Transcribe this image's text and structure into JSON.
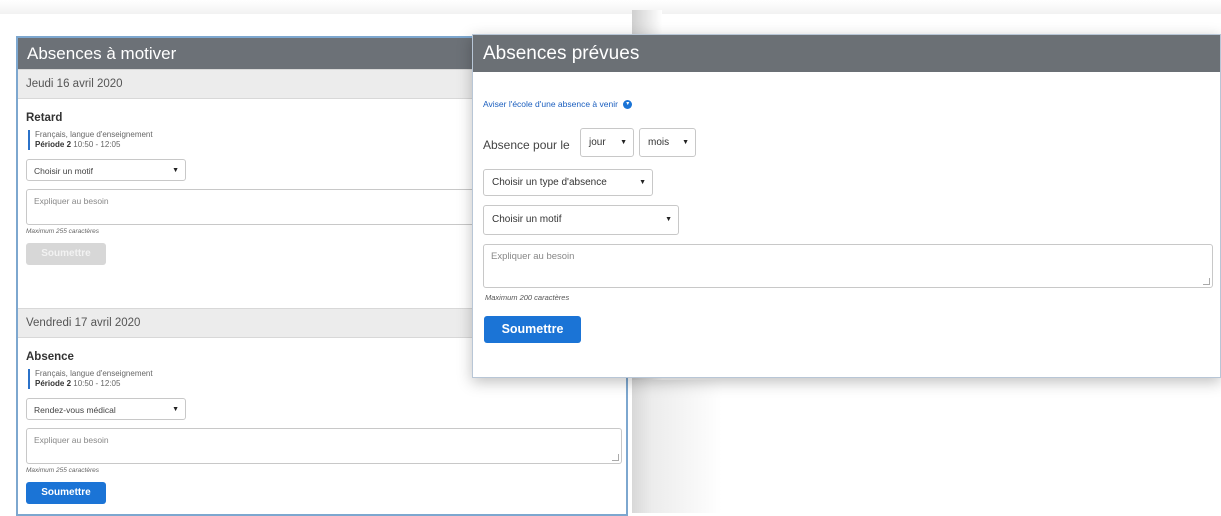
{
  "left_panel": {
    "title": "Absences à motiver",
    "days": [
      {
        "date": "Jeudi 16 avril 2020",
        "type": "Retard",
        "course": "Français, langue d'enseignement",
        "period_label": "Période 2",
        "period_time": "10:50 - 12:05",
        "motif": "Choisir un motif",
        "textarea_placeholder": "Expliquer au besoin",
        "max_note": "Maximum 255 caractères",
        "submit_label": "Soumettre",
        "submit_enabled": false
      },
      {
        "date": "Vendredi 17 avril 2020",
        "type": "Absence",
        "course": "Français, langue d'enseignement",
        "period_label": "Période 2",
        "period_time": "10:50 - 12:05",
        "motif": "Rendez-vous médical",
        "textarea_placeholder": "Expliquer au besoin",
        "max_note": "Maximum 255 caractères",
        "submit_label": "Soumettre",
        "submit_enabled": true
      }
    ]
  },
  "right_panel": {
    "title": "Absences prévues",
    "notify_link": "Aviser l'école d'une absence à venir",
    "absence_for_label": "Absence pour le",
    "day_select": "jour",
    "month_select": "mois",
    "type_select": "Choisir un type d'absence",
    "motif_select": "Choisir un motif",
    "textarea_placeholder": "Expliquer au besoin",
    "max_note": "Maximum 200 caractères",
    "submit_label": "Soumettre"
  },
  "colors": {
    "header_bg": "#6c7177",
    "primary_button": "#1b74d6",
    "panel_border": "#7da7cf"
  },
  "icons": {
    "dropdown": "caret-down-icon",
    "info": "circle-arrow-icon"
  }
}
